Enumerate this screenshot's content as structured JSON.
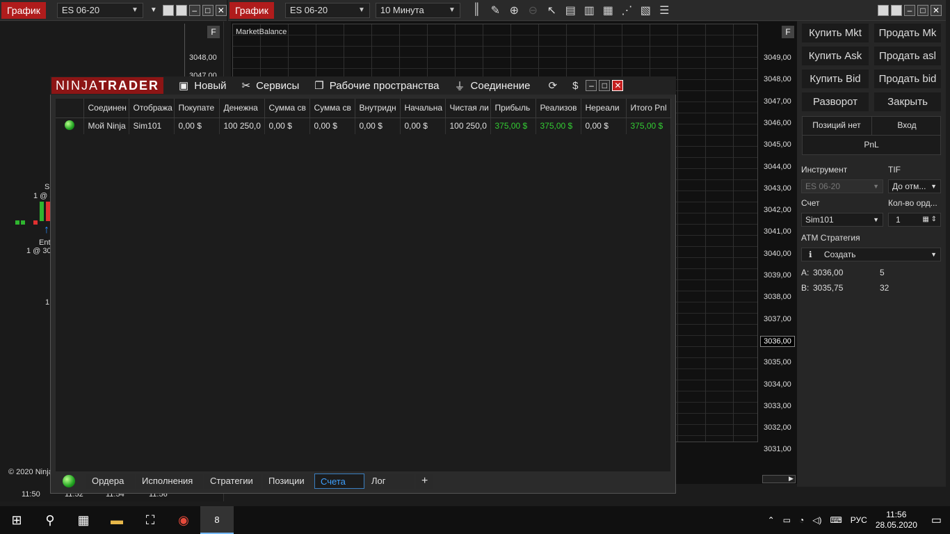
{
  "left_window": {
    "tab": "График",
    "instrument": "ES 06-20",
    "f_label": "F",
    "prices": [
      "3048,00",
      "3047,00"
    ],
    "copyright": "© 2020 Ninja",
    "times": [
      "11:50",
      "11:52",
      "11:54",
      "11:56"
    ],
    "marker_s": "S",
    "marker_qty_top": "1 @ 3",
    "entry_label": "Ent",
    "marker_qty_bottom": "1 @ 30",
    "marker_one": "1"
  },
  "main_window": {
    "tab": "График",
    "instrument": "ES 06-20",
    "interval": "10 Минута",
    "indicator_label": "MarketBalance",
    "f_label": "F",
    "axis": [
      "3049,00",
      "3048,00",
      "3047,00",
      "3046,00",
      "3045,00",
      "3044,00",
      "3043,00",
      "3042,00",
      "3041,00",
      "3040,00",
      "3039,00",
      "3038,00",
      "3037,00",
      "3036,00",
      "3035,00",
      "3034,00",
      "3033,00",
      "3032,00",
      "3031,00"
    ],
    "current_price": "3036,00"
  },
  "order_panel": {
    "buttons": [
      [
        "Купить Mkt",
        "Продать Mk"
      ],
      [
        "Купить Ask",
        "Продать asl"
      ],
      [
        "Купить Bid",
        "Продать bid"
      ],
      [
        "Разворот",
        "Закрыть"
      ]
    ],
    "position_label": "Позиций нет",
    "entry_label": "Вход",
    "pnl_label": "PnL",
    "instrument_label": "Инструмент",
    "tif_label": "TIF",
    "instrument_value": "ES 06-20",
    "tif_value": "До отм...",
    "account_label": "Счет",
    "qty_label": "Кол-во орд...",
    "account_value": "Sim101",
    "qty_value": "1",
    "atm_label": "ATM Стратегия",
    "atm_value": "Создать",
    "ask_label": "A:",
    "ask_price": "3036,00",
    "ask_size": "5",
    "bid_label": "B:",
    "bid_price": "3035,75",
    "bid_size": "32"
  },
  "control_center": {
    "logo_left": "NINJA",
    "logo_right": "TRADER",
    "menu": [
      "Новый",
      "Сервисы",
      "Рабочие пространства",
      "Соединение"
    ],
    "columns": [
      "Соединен",
      "Отобража",
      "Покупате",
      "Денежна",
      "Сумма св",
      "Сумма св",
      "Внутридн",
      "Начальна",
      "Чистая ли",
      "Прибыль",
      "Реализов",
      "Нереали",
      "Итого Pnl"
    ],
    "row": [
      "Мой Ninja",
      "Sim101",
      "0,00 $",
      "100 250,0",
      "0,00 $",
      "0,00 $",
      "0,00 $",
      "0,00 $",
      "100 250,0",
      "375,00 $",
      "375,00 $",
      "0,00 $",
      "375,00 $"
    ],
    "tabs": [
      "Ордера",
      "Исполнения",
      "Стратегии",
      "Позиции",
      "Счета",
      "Лог"
    ],
    "active_tab": "Счета"
  },
  "taskbar": {
    "language": "РУС",
    "time": "11:56",
    "date": "28.05.2020",
    "badge": "8"
  },
  "colors": {
    "accent_red": "#b01c1c",
    "profit_green": "#33cc33",
    "active_tab_blue": "#3ea0ff"
  }
}
